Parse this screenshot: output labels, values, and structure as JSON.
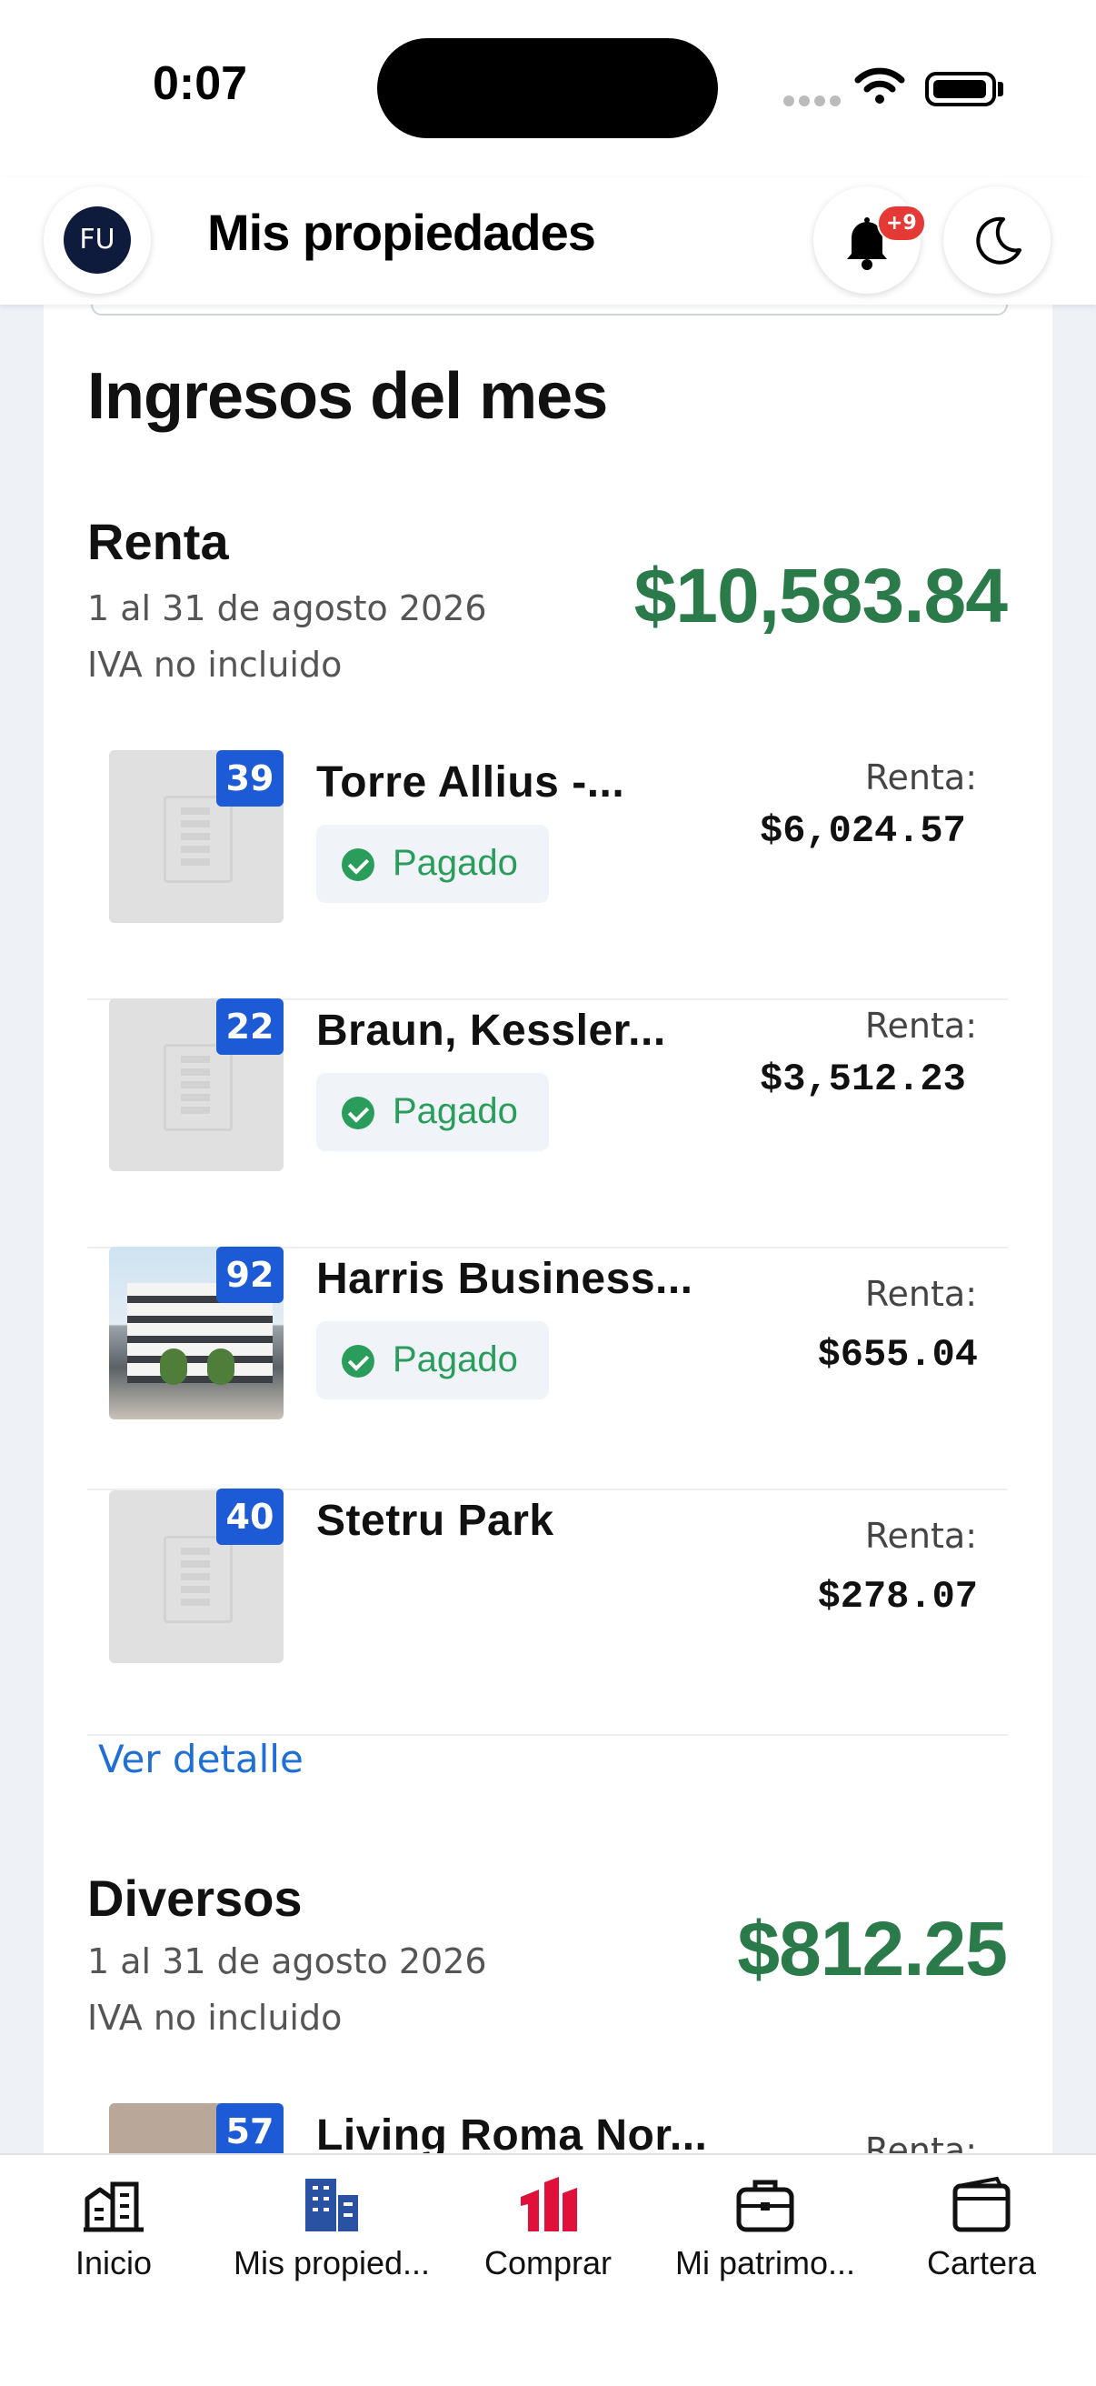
{
  "status_bar": {
    "time": "0:07"
  },
  "header": {
    "avatar_initials": "FU",
    "title": "Mis propiedades",
    "notifications_badge": "+9"
  },
  "income": {
    "title": "Ingresos del mes",
    "rent": {
      "title": "Renta",
      "period": "1 al 31 de agosto 2026",
      "tax_note": "IVA no incluido",
      "total": "$10,583.84",
      "items": [
        {
          "unit": "39",
          "name": "Torre Allius -...",
          "status": "Pagado",
          "rent_label": "Renta:",
          "rent": "$6,024.57",
          "has_photo": false
        },
        {
          "unit": "22",
          "name": "Braun, Kessler...",
          "status": "Pagado",
          "rent_label": "Renta:",
          "rent": "$3,512.23",
          "has_photo": false
        },
        {
          "unit": "92",
          "name": "Harris Business...",
          "status": "Pagado",
          "rent_label": "Renta:",
          "rent": "$655.04",
          "has_photo": true
        },
        {
          "unit": "40",
          "name": "Stetru Park",
          "status": "",
          "rent_label": "Renta:",
          "rent": "$278.07",
          "has_photo": false
        }
      ],
      "detail_link": "Ver detalle"
    },
    "misc": {
      "title": "Diversos",
      "period": "1 al 31 de agosto 2026",
      "tax_note": "IVA no incluido",
      "total": "$812.25",
      "items": [
        {
          "unit": "57",
          "name": "Living Roma Nor...",
          "rent_label": "Renta:"
        }
      ]
    }
  },
  "tabbar": {
    "items": [
      {
        "label": "Inicio",
        "icon": "home-chart-icon"
      },
      {
        "label": "Mis propied...",
        "icon": "buildings-icon"
      },
      {
        "label": "Comprar",
        "icon": "brand-logo-icon"
      },
      {
        "label": "Mi patrimo...",
        "icon": "briefcase-icon"
      },
      {
        "label": "Cartera",
        "icon": "wallet-icon"
      }
    ]
  },
  "colors": {
    "accent_green": "#2a7a4a",
    "paid_green": "#2a9d5c",
    "unit_badge": "#1d5bd6",
    "link_blue": "#1f6fd6",
    "brand_red": "#e0103a"
  }
}
